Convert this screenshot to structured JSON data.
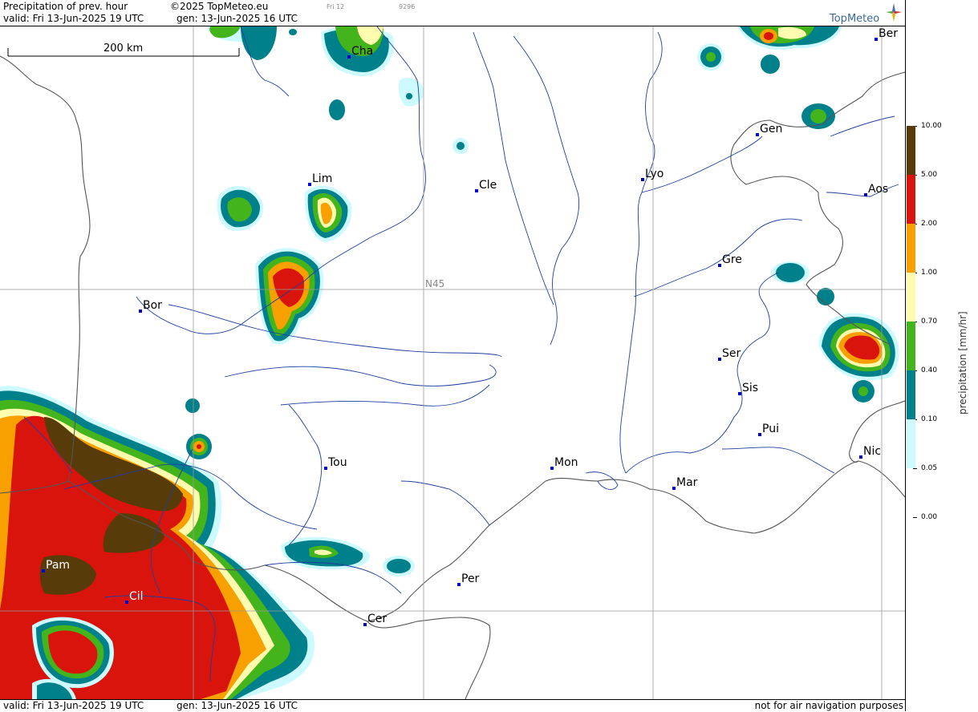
{
  "header": {
    "product": "Precipitation of prev. hour",
    "copyright": "©2025 TopMeteo.eu",
    "tag": "Fri 12",
    "code": "9296",
    "valid": "valid:  Fri  13-Jun-2025  19 UTC",
    "gen": "gen: 13-Jun-2025 16 UTC",
    "brand": "TopMeteo"
  },
  "scale": {
    "label": "200 km"
  },
  "grid": {
    "label": "N45"
  },
  "cities": [
    {
      "name": "Cha"
    },
    {
      "name": "Ber"
    },
    {
      "name": "Gen"
    },
    {
      "name": "Lim"
    },
    {
      "name": "Cle"
    },
    {
      "name": "Lyo"
    },
    {
      "name": "Aos"
    },
    {
      "name": "Gre"
    },
    {
      "name": "Bor"
    },
    {
      "name": "Ser"
    },
    {
      "name": "Sis"
    },
    {
      "name": "Pui"
    },
    {
      "name": "Nic"
    },
    {
      "name": "Tou"
    },
    {
      "name": "Mon"
    },
    {
      "name": "Mar"
    },
    {
      "name": "Pam"
    },
    {
      "name": "Cil"
    },
    {
      "name": "Per"
    },
    {
      "name": "Cer"
    }
  ],
  "legend": {
    "title": "precipitation  [mm/hr]",
    "levels": [
      {
        "label": "10.00",
        "color": "#573c0a"
      },
      {
        "label": "5.00",
        "color": "#d8140c"
      },
      {
        "label": "2.00",
        "color": "#f7a000"
      },
      {
        "label": "1.00",
        "color": "#fffcb0"
      },
      {
        "label": "0.70",
        "color": "#44b41c"
      },
      {
        "label": "0.40",
        "color": "#00808a"
      },
      {
        "label": "0.10",
        "color": "#ccfaff"
      },
      {
        "label": "0.05",
        "color": "#ffffff"
      },
      {
        "label": "0.00",
        "color": "#ffffff"
      }
    ]
  },
  "footer": {
    "valid": "valid:  Fri  13-Jun-2025  19 UTC",
    "gen": "gen: 13-Jun-2025 16 UTC",
    "note": "not for air navigation purposes"
  }
}
